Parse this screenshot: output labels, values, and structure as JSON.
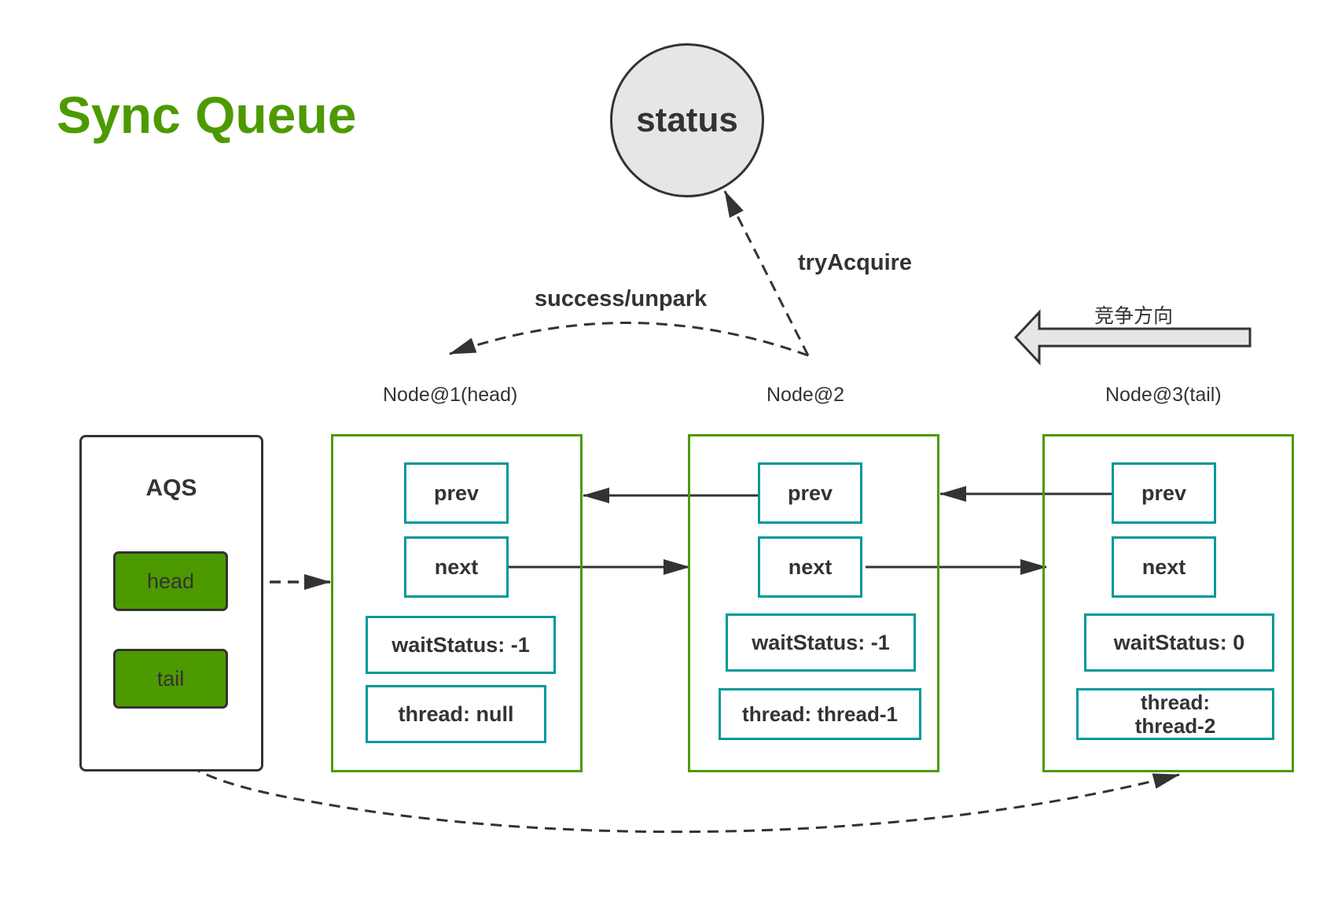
{
  "title": "Sync Queue",
  "colors": {
    "accent_green": "#4d9a00",
    "field_teal": "#009999",
    "stroke_dark": "#333333",
    "status_fill": "#e6e6e6"
  },
  "status_node": {
    "label": "status"
  },
  "edge_labels": {
    "try_acquire": "tryAcquire",
    "success_unpark": "success/unpark"
  },
  "direction_arrow": {
    "label": "竞争方向",
    "direction": "left"
  },
  "aqs": {
    "title": "AQS",
    "fields": [
      {
        "label": "head"
      },
      {
        "label": "tail"
      }
    ]
  },
  "nodes": [
    {
      "caption": "Node@1(head)",
      "prev": "prev",
      "next": "next",
      "wait_status": "waitStatus: -1",
      "thread": "thread: null"
    },
    {
      "caption": "Node@2",
      "prev": "prev",
      "next": "next",
      "wait_status": "waitStatus: -1",
      "thread": "thread: thread-1"
    },
    {
      "caption": "Node@3(tail)",
      "prev": "prev",
      "next": "next",
      "wait_status": "waitStatus: 0",
      "thread": "thread: thread-2"
    }
  ]
}
